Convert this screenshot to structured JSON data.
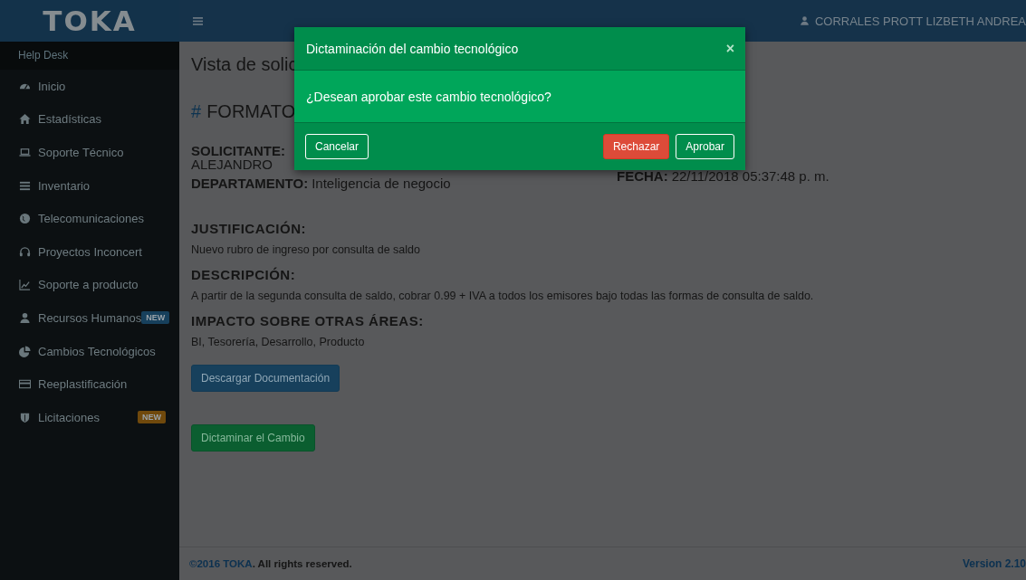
{
  "topbar": {
    "logo": "TOKA",
    "user": "CORRALES PROTT LIZBETH ANDREA"
  },
  "sidebar": {
    "header": "Help Desk",
    "items": [
      {
        "label": "Inicio"
      },
      {
        "label": "Estadísticas"
      },
      {
        "label": "Soporte Técnico"
      },
      {
        "label": "Inventario"
      },
      {
        "label": "Telecomunicaciones"
      },
      {
        "label": "Proyectos Inconcert"
      },
      {
        "label": "Soporte a producto"
      },
      {
        "label": "Recursos Humanos",
        "badge": {
          "text": "NEW",
          "color": "#17405c"
        }
      },
      {
        "label": "Cambios Tecnológicos"
      },
      {
        "label": "Reeplastificación"
      },
      {
        "label": "Licitaciones",
        "badge": {
          "text": "NEW",
          "color": "#70490c"
        }
      }
    ]
  },
  "content": {
    "title": "Vista de solic",
    "heading_mark": "#",
    "heading": "FORMATO",
    "requester": {
      "label": "SOLICITANTE:",
      "continuation": "ALEJANDRO"
    },
    "date": {
      "label": "FECHA:",
      "value": "22/11/2018 05:37:48 p. m."
    },
    "department": {
      "label": "DEPARTAMENTO:",
      "value": "Inteligencia de negocio"
    },
    "sections": [
      {
        "heading": "JUSTIFICACIÓN:",
        "text": "Nuevo rubro de ingreso por consulta de saldo"
      },
      {
        "heading": "DESCRIPCIÓN:",
        "text": "A partir de la segunda consulta de saldo, cobrar 0.99 + IVA a todos los emisores bajo todas las formas de consulta de saldo."
      },
      {
        "heading": "IMPACTO SOBRE OTRAS ÁREAS:",
        "text": "BI, Tesorería, Desarrollo, Producto"
      }
    ],
    "buttons": [
      {
        "label": "Descargar Documentación",
        "kind": "primary"
      },
      {
        "label": "Dictaminar el Cambio",
        "kind": "success"
      }
    ]
  },
  "footer": {
    "copyright": "©2016 TOKA",
    "rights": ". All rights reserved.",
    "version": "Version 2.10"
  },
  "modal": {
    "title": "Dictaminación del cambio tecnológico",
    "close": "×",
    "message": "¿Desean aprobar este cambio tecnológico?",
    "buttons": [
      {
        "label": "Cancelar",
        "kind": "outline"
      },
      {
        "label": "Rechazar",
        "kind": "danger"
      },
      {
        "label": "Aprobar",
        "kind": "outline"
      }
    ]
  }
}
